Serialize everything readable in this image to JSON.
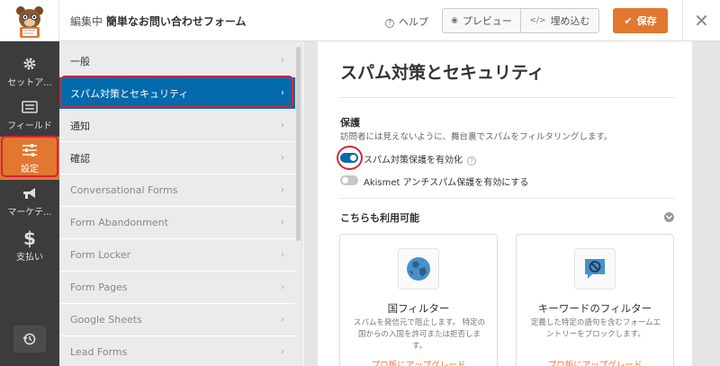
{
  "header": {
    "editing_prefix": "編集中",
    "form_name": "簡単なお問い合わせフォーム",
    "help_label": "ヘルプ",
    "preview_label": "プレビュー",
    "embed_label": "埋め込む",
    "save_label": "保存"
  },
  "leftnav": {
    "items": [
      {
        "label": "セットア...",
        "icon": "gear-icon"
      },
      {
        "label": "フィールド",
        "icon": "fields-icon"
      },
      {
        "label": "設定",
        "icon": "sliders-icon",
        "active": true
      },
      {
        "label": "マーケテ...",
        "icon": "megaphone-icon"
      },
      {
        "label": "支払い",
        "icon": "dollar-icon"
      }
    ]
  },
  "sections": {
    "items": [
      {
        "label": "一般"
      },
      {
        "label": "スパム対策とセキュリティ",
        "active": true
      },
      {
        "label": "通知"
      },
      {
        "label": "確認"
      },
      {
        "label": "Conversational Forms",
        "dim": true
      },
      {
        "label": "Form Abandonment",
        "dim": true
      },
      {
        "label": "Form Locker",
        "dim": true
      },
      {
        "label": "Form Pages",
        "dim": true
      },
      {
        "label": "Google Sheets",
        "dim": true
      },
      {
        "label": "Lead Forms",
        "dim": true
      }
    ]
  },
  "main": {
    "title": "スパム対策とセキュリティ",
    "protection_title": "保護",
    "protection_desc": "訪問者には見えないように、舞台裏でスパムをフィルタリングします。",
    "toggle_antispam": {
      "label": "スパム対策保護を有効化",
      "on": true
    },
    "toggle_akismet": {
      "label": "Akismet アンチスパム保護を有効にする",
      "on": false
    },
    "also_available": "こちらも利用可能",
    "addons": [
      {
        "name": "国フィルター",
        "desc": "スパムを発信元で阻止します。 特定の国からの入国を許可または拒否します。",
        "link": "プロ版にアップグレード",
        "icon": "globe-icon"
      },
      {
        "name": "キーワードのフィルター",
        "desc": "定義した特定の語句を含むフォームエントリーをブロックします。",
        "link": "プロ版にアップグレード",
        "icon": "no-keyword-icon"
      }
    ]
  },
  "colors": {
    "accent": "#e27730",
    "active_blue": "#036aab",
    "highlight_red": "#d6243b",
    "sidebar_dark": "#3c3c3c"
  }
}
